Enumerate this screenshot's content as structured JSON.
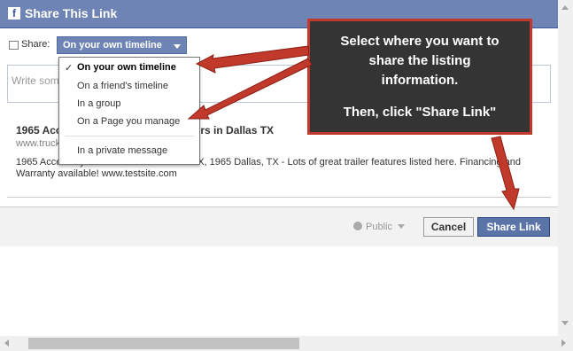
{
  "dialog": {
    "title": "Share This Link",
    "logo": "f"
  },
  "share": {
    "label": "Share:",
    "selected": "On your own timeline"
  },
  "composer": {
    "placeholder": "Write something..."
  },
  "link": {
    "title": "1965 Accessory Trailer... Great Trailers in Dallas TX",
    "url": "www.truck...",
    "description": "1965 Accessory Trailer for sale in Dallas TX, 1965 Dallas, TX - Lots of great trailer features listed here. Financing and Warranty available! www.testsite.com"
  },
  "dropdown": {
    "check": "✓",
    "items": [
      {
        "label": "On your own timeline",
        "selected": true
      },
      {
        "label": "On a friend's timeline",
        "selected": false
      },
      {
        "label": "In a group",
        "selected": false
      },
      {
        "label": "On a Page you manage",
        "selected": false
      },
      {
        "label": "In a private message",
        "selected": false
      }
    ]
  },
  "footer": {
    "privacy": "Public",
    "cancel_label": "Cancel",
    "share_label": "Share Link"
  },
  "callout": {
    "line1": "Select where you want to",
    "line2": "share the listing",
    "line3": "information.",
    "line4": "Then, click \"Share Link\""
  },
  "colors": {
    "header": "#6d84b4",
    "button": "#5b74a8",
    "callout_bg": "#343434",
    "callout_border": "#c0392b"
  }
}
